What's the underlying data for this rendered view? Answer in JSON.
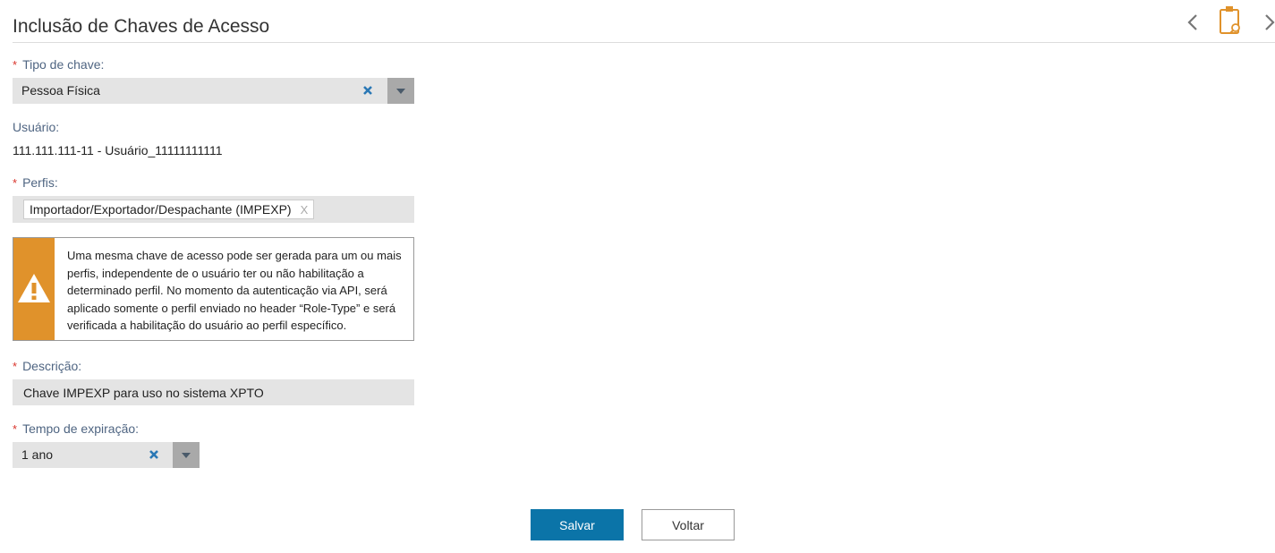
{
  "header": {
    "title": "Inclusão de Chaves de Acesso",
    "icons": [
      "chevron-left-icon",
      "clipboard-search-icon",
      "chevron-right-icon"
    ]
  },
  "form": {
    "tipo_chave": {
      "label": "Tipo de chave:",
      "value": "Pessoa Física"
    },
    "usuario": {
      "label": "Usuário:",
      "value": "111.111.111-11 - Usuário_11111111111"
    },
    "perfis": {
      "label": "Perfis:",
      "tags": [
        "Importador/Exportador/Despachante (IMPEXP)"
      ],
      "remove_label": "X"
    },
    "warning": {
      "text": "Uma mesma chave de acesso pode ser gerada para um ou mais perfis, independente de o usuário ter ou não habilitação a determinado perfil. No momento da autenticação via API, será aplicado somente o perfil enviado no header “Role-Type” e será verificada a habilitação do usuário ao perfil específico."
    },
    "descricao": {
      "label": "Descrição:",
      "value": "Chave IMPEXP para uso no sistema XPTO"
    },
    "tempo_expiracao": {
      "label": "Tempo de expiração:",
      "value": "1 ano"
    },
    "required_mark": "*"
  },
  "actions": {
    "save_label": "Salvar",
    "back_label": "Voltar"
  },
  "colors": {
    "accent": "#0b74a8",
    "warning": "#e0922b",
    "required": "#d9342b",
    "label": "#4f6582",
    "field_bg": "#e4e4e4"
  }
}
